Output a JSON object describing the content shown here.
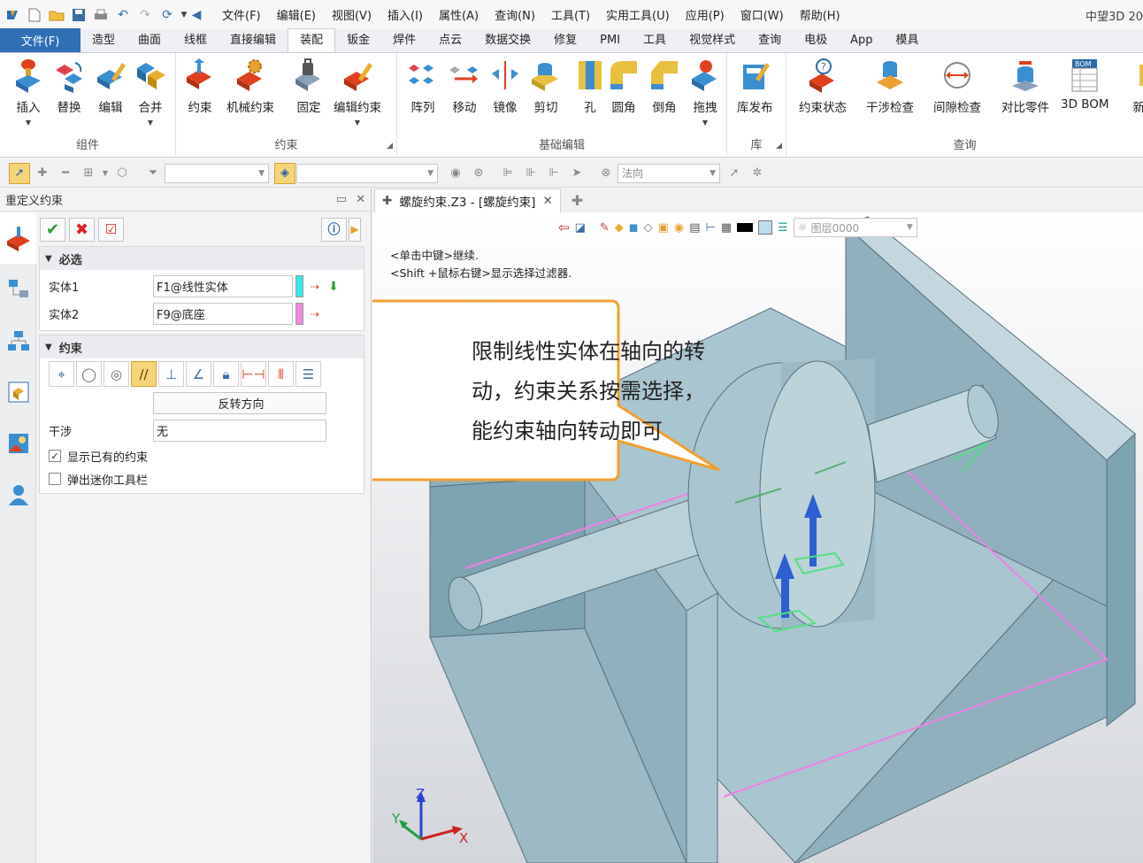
{
  "menubar": {
    "items": [
      "文件(F)",
      "编辑(E)",
      "视图(V)",
      "插入(I)",
      "属性(A)",
      "查询(N)",
      "工具(T)",
      "实用工具(U)",
      "应用(P)",
      "窗口(W)",
      "帮助(H)"
    ],
    "app_title": "中望3D 20"
  },
  "ribbon_tabs": {
    "file": "文件(F)",
    "items": [
      "造型",
      "曲面",
      "线框",
      "直接编辑",
      "装配",
      "钣金",
      "焊件",
      "点云",
      "数据交换",
      "修复",
      "PMI",
      "工具",
      "视觉样式",
      "查询",
      "电极",
      "App",
      "模具"
    ],
    "active": "装配"
  },
  "ribbon": {
    "groups": [
      {
        "label": "组件",
        "buttons": [
          "插入",
          "替换",
          "编辑",
          "合并"
        ]
      },
      {
        "label": "约束",
        "buttons": [
          "约束",
          "机械约束",
          "固定",
          "编辑约束"
        ]
      },
      {
        "label": "基础编辑",
        "buttons": [
          "阵列",
          "移动",
          "镜像",
          "剪切",
          "孔",
          "圆角",
          "倒角",
          "拖拽"
        ]
      },
      {
        "label": "库",
        "buttons": [
          "库发布"
        ]
      },
      {
        "label": "查询",
        "buttons": [
          "约束状态",
          "干涉检查",
          "间隙检查",
          "对比零件",
          "3D BOM",
          "新建"
        ]
      }
    ]
  },
  "toolbar2": {
    "view_select": "法向"
  },
  "panel": {
    "title": "重定义约束",
    "required_section": "必选",
    "entity1_label": "实体1",
    "entity1_value": "F1@线性实体",
    "entity1_color": "#38e8e8",
    "entity2_label": "实体2",
    "entity2_value": "F9@底座",
    "entity2_color": "#f08ae0",
    "constraint_section": "约束",
    "reverse_button": "反转方向",
    "interference_label": "干涉",
    "interference_value": "无",
    "show_existing_label": "显示已有的约束",
    "show_existing_checked": true,
    "popup_toolbar_label": "弹出迷你工具栏",
    "popup_toolbar_checked": false
  },
  "document": {
    "tab_title": "螺旋约束.Z3 - [螺旋约束]",
    "layer": "图层0000"
  },
  "viewport": {
    "hint1": "<单击中键>继续.",
    "hint2": "<Shift +鼠标右键>显示选择过滤器.",
    "callout_lines": [
      "限制线性实体在轴向的转",
      "动，约束关系按需选择，",
      "能约束轴向转动即可"
    ],
    "axes": {
      "x": "X",
      "y": "Y",
      "z": "Z"
    }
  },
  "colors": {
    "accent": "#2f6fb4",
    "model": "#a9c5cf",
    "callout_border": "#f0a030",
    "highlight_pink": "#f080e8",
    "arrow_blue": "#2d5fd0"
  }
}
